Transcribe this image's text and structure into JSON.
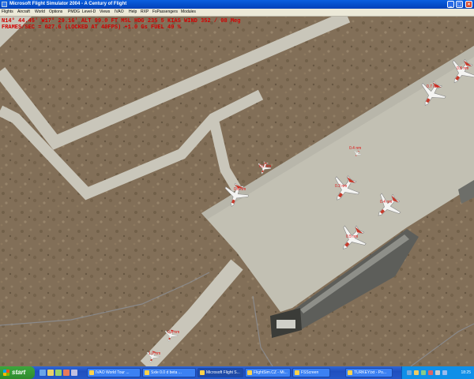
{
  "window": {
    "title": "Microsoft Flight Simulator 2004 - A Century of Flight",
    "buttons": {
      "minimize": "_",
      "maximize": "□",
      "close": "×"
    }
  },
  "menu": [
    "Flights",
    "Aircraft",
    "World",
    "Options",
    "PMDG",
    "Level-D",
    "Views",
    "IVAO",
    "Help",
    "RXP",
    "FsPassengers",
    "Modules"
  ],
  "hud": {
    "line1": "N14° 44.45'  W17° 29.16'  ALT 99.0 FT  MSL  HDG 235   5 KIAS  WIND 352 / 08 Meg",
    "line2": "FRAMES/SEC = 027.6 (LOCKED AT 40FPS)    +1.0 Gs  FUEL  49 %"
  },
  "ai_labels": {
    "center": "0.4 nm",
    "mid": "0.3 nm",
    "right": "0.4 nm",
    "top_right": "0.7 nm",
    "upper_right": "0.8 nm",
    "lower_center": "0.5 nm",
    "lower_left": "0.6 nm",
    "bottom_left": "0.8 nm",
    "bottom_left_2": "1.0 nm",
    "gate_left": "0.2 nm"
  },
  "taskbar": {
    "start_label": "start",
    "tasks": [
      "IVAO World Tour ...",
      "Sxle 0.0 d beta ...",
      "Microsoft Flight S...",
      "FlightSim.CZ - Mi...",
      "FSScreen",
      "TURKEY.txt - Po..."
    ],
    "clock": "18:25"
  },
  "colors": {
    "terrain": "#85715a",
    "taxiway": "#c9c6ba",
    "apron": "#c2c0b3",
    "hud_text": "#d10000",
    "taskbar": "#245edb",
    "start_green": "#3ca73c"
  }
}
